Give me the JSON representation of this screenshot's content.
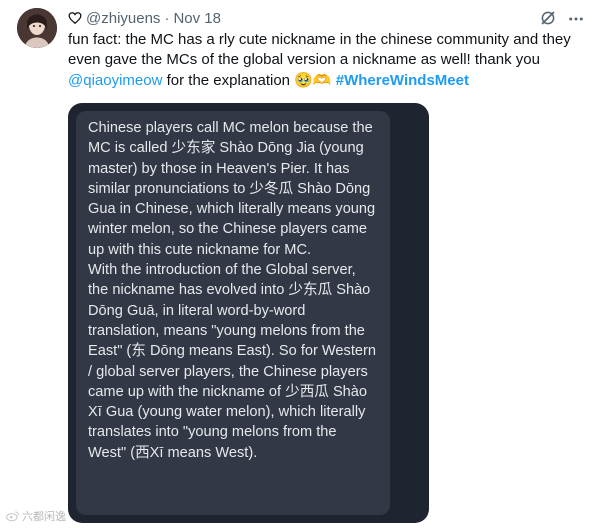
{
  "tweet": {
    "avatar_icon": "user-avatar",
    "heart_icon": "heart-outline-icon",
    "handle": "@zhiyuens",
    "separator": "·",
    "date": "Nov 18",
    "text_parts": {
      "body": "fun fact: the MC has a rly cute nickname in the chinese community and they even gave the MCs of the global version a nickname as well! thank you ",
      "mention": "@qiaoyimeow",
      "after_mention": " for the explanation ",
      "emojis": "🥹🫶",
      "space": " ",
      "hashtag": "#WhereWindsMeet"
    },
    "actions": {
      "grok_icon": "grok-icon",
      "more_icon": "more-dots-icon"
    },
    "media": {
      "paragraph_1": "Chinese players call MC melon because the MC is called 少东家 Shào Dōng Jia (young master) by those in Heaven's Pier. It has similar pronunciations to 少冬瓜 Shào Dōng Gua in Chinese, which literally means young winter melon, so the Chinese players came up with this cute nickname for MC.",
      "paragraph_2": "With the introduction of the Global server, the nickname has evolved into 少东瓜 Shào Dōng Guā, in literal word-by-word translation, means \"young melons from the East\" (东 Dōng means East). So for Western / global server players, the Chinese players came up with the nickname of 少西瓜 Shào Xī Gua (young water melon), which literally translates into \"young melons from the West\" (西Xī means West)."
    }
  },
  "watermark": {
    "icon": "weibo-logo",
    "text": "六都闲逸"
  },
  "colors": {
    "link": "#1d9bf0",
    "text": "#0f1419",
    "muted": "#536471",
    "card_bg": "#323845",
    "media_bg": "#1e2430"
  }
}
